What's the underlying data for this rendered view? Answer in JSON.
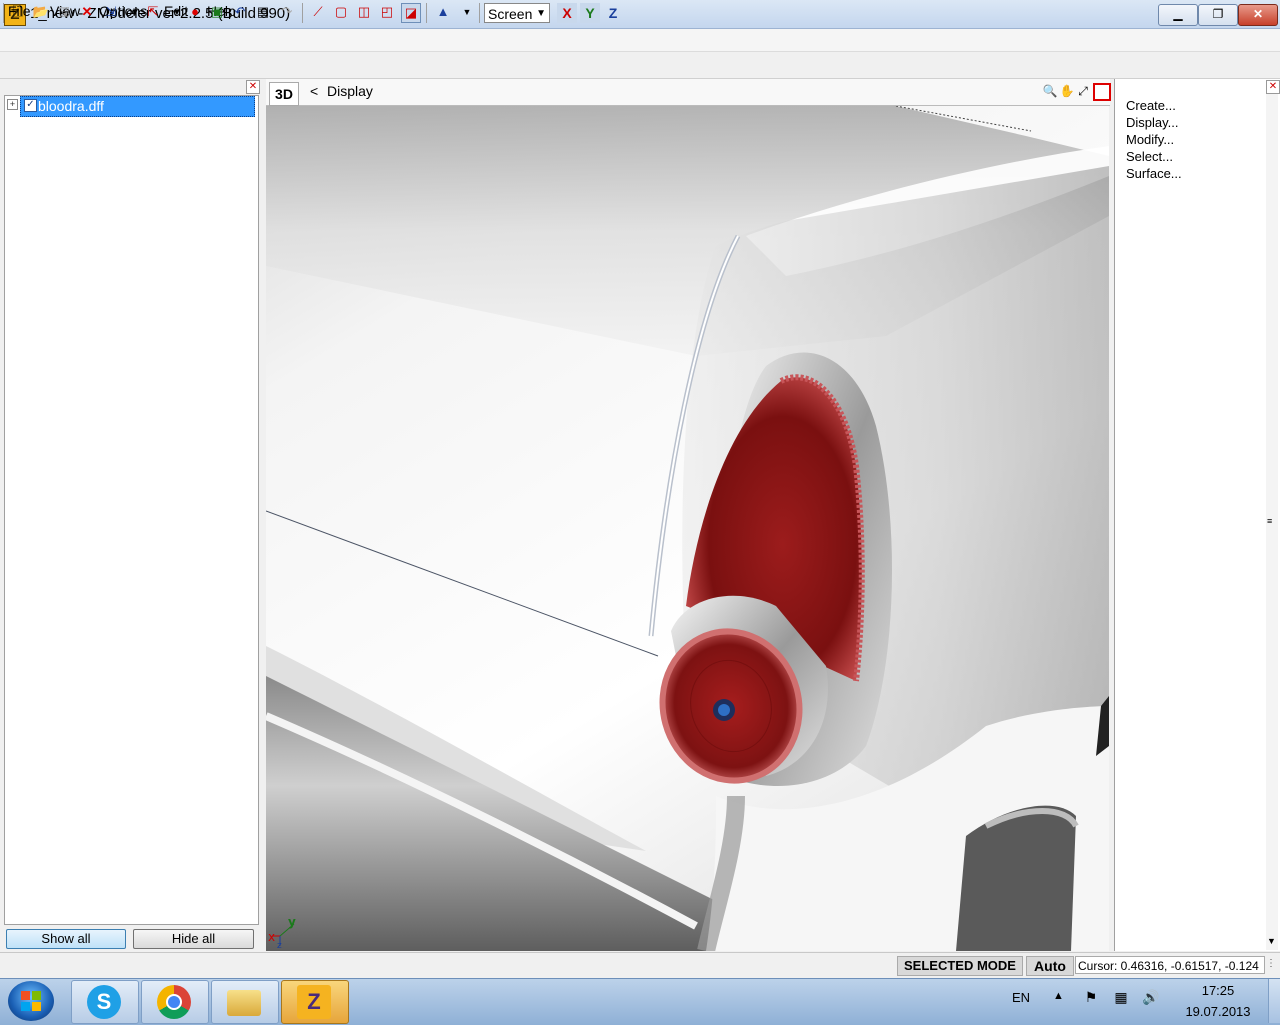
{
  "window": {
    "title": "1_new - ZModeler ver 2.2.5 (Build 990)",
    "app_icon": "Z",
    "minimize_icon": "minimize-icon",
    "maximize_icon": "restore-icon",
    "close_icon": "close-icon"
  },
  "menu": {
    "items": [
      {
        "label": "File",
        "accel": "F"
      },
      {
        "label": "View",
        "accel": "V"
      },
      {
        "label": "Options",
        "accel": "O"
      },
      {
        "label": "Edit",
        "accel": "E"
      },
      {
        "label": "Help",
        "accel": "H"
      }
    ]
  },
  "toolbar": {
    "view_mode_select": "Screen",
    "axis_x": "X",
    "axis_y": "Y",
    "axis_z": "Z"
  },
  "tree": {
    "items": [
      {
        "label": "bloodra.dff",
        "checked": true,
        "expanded": false
      }
    ]
  },
  "left_panel": {
    "show_all": "Show all",
    "hide_all": "Hide all"
  },
  "viewport": {
    "mode_label": "3D",
    "back_arrow": "<",
    "title": "Display",
    "gizmo_x": "x",
    "gizmo_y": "y",
    "gizmo_z": "z"
  },
  "right_panel": {
    "items": [
      "Create...",
      "Display...",
      "Modify...",
      "Select...",
      "Surface..."
    ]
  },
  "status": {
    "mode": "SELECTED MODE",
    "auto": "Auto",
    "cursor": "Cursor: 0.46316, -0.61517, -0.124"
  },
  "taskbar": {
    "apps": [
      "skype",
      "chrome",
      "explorer",
      "zmodeler"
    ],
    "zmodeler_letter": "Z",
    "language": "EN",
    "time": "17:25",
    "date": "19.07.2013"
  },
  "colors": {
    "selection": "#3399ff",
    "taillight_red": "#8b1a1a",
    "car_body": "#f2f2f2",
    "chrome": "#c8c8c8"
  }
}
